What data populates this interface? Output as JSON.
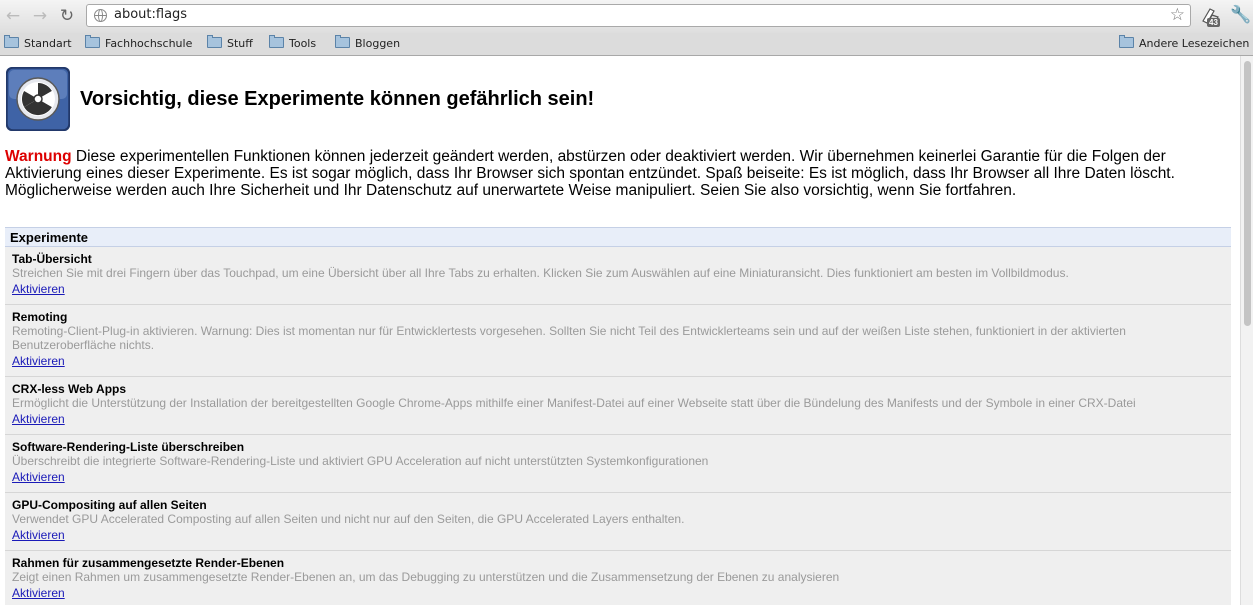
{
  "toolbar": {
    "url": "about:flags",
    "extension_badge": "43"
  },
  "bookmarks": {
    "items": [
      "Standart",
      "Fachhochschule",
      "Stuff",
      "Tools",
      "Bloggen"
    ],
    "other": "Andere Lesezeichen"
  },
  "page": {
    "title": "Vorsichtig, diese Experimente können gefährlich sein!",
    "warning_label": "Warnung",
    "warning_text": "Diese experimentellen Funktionen können jederzeit geändert werden, abstürzen oder deaktiviert werden. Wir übernehmen keinerlei Garantie für die Folgen der Aktivierung eines dieser Experimente. Es ist sogar möglich, dass Ihr Browser sich spontan entzündet. Spaß beiseite: Es ist möglich, dass Ihr Browser all Ihre Daten löscht. Möglicherweise werden auch Ihre Sicherheit und Ihr Datenschutz auf unerwartete Weise manipuliert. Seien Sie also vorsichtig, wenn Sie fortfahren.",
    "section_title": "Experimente"
  },
  "experiments": [
    {
      "name": "Tab-Übersicht",
      "desc": "Streichen Sie mit drei Fingern über das Touchpad, um eine Übersicht über all Ihre Tabs zu erhalten. Klicken Sie zum Auswählen auf eine Miniaturansicht. Dies funktioniert am besten im Vollbildmodus.",
      "action": "Aktivieren"
    },
    {
      "name": "Remoting",
      "desc": "Remoting-Client-Plug-in aktivieren. Warnung: Dies ist momentan nur für Entwicklertests vorgesehen. Sollten Sie nicht Teil des Entwicklerteams sein und auf der weißen Liste stehen, funktioniert in der aktivierten Benutzeroberfläche nichts.",
      "action": "Aktivieren"
    },
    {
      "name": "CRX-less Web Apps",
      "desc": "Ermöglicht die Unterstützung der Installation der bereitgestellten Google Chrome-Apps mithilfe einer Manifest-Datei auf einer Webseite statt über die Bündelung des Manifests und der Symbole in einer CRX-Datei",
      "action": "Aktivieren"
    },
    {
      "name": "Software-Rendering-Liste überschreiben",
      "desc": "Überschreibt die integrierte Software-Rendering-Liste und aktiviert GPU Acceleration auf nicht unterstützten Systemkonfigurationen",
      "action": "Aktivieren"
    },
    {
      "name": "GPU-Compositing auf allen Seiten",
      "desc": "Verwendet GPU Accelerated Composting auf allen Seiten und nicht nur auf den Seiten, die GPU Accelerated Layers enthalten.",
      "action": "Aktivieren"
    },
    {
      "name": "Rahmen für zusammengesetzte Render-Ebenen",
      "desc": "Zeigt einen Rahmen um zusammengesetzte Render-Ebenen an, um das Debugging zu unterstützen und die Zusammensetzung der Ebenen zu analysieren",
      "action": "Aktivieren"
    }
  ]
}
